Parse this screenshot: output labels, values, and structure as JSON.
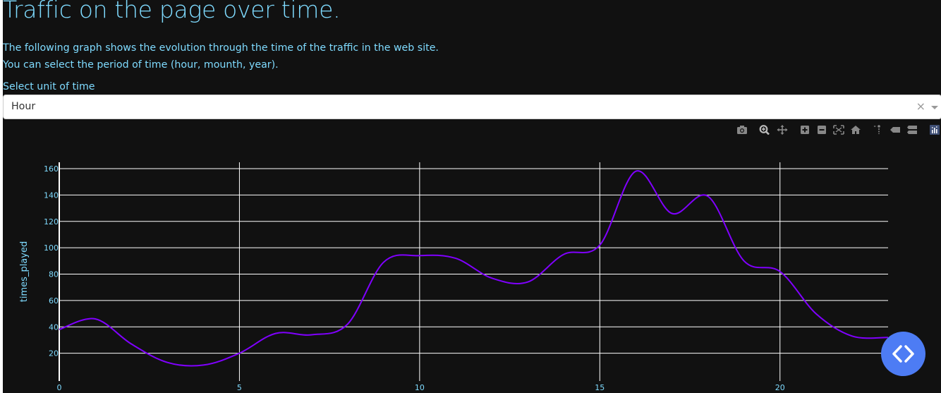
{
  "page": {
    "title": "Traffic on the page over time.",
    "description_line1": "The following graph shows the evolution through the time of the traffic in the web site.",
    "description_line2": "You can select the period of time (hour, mounth, year).",
    "select_label": "Select unit of time",
    "select_value": "Hour",
    "clear_symbol": "×"
  },
  "modebar": {
    "buttons": [
      "camera-icon",
      "zoom-icon",
      "pan-icon",
      "zoom-in-icon",
      "zoom-out-icon",
      "autoscale-icon",
      "reset-axes-icon",
      "spike-lines-icon",
      "hover-closest-icon",
      "hover-compare-icon",
      "plotly-logo-icon"
    ]
  },
  "colors": {
    "accent_text": "#7fdbff",
    "background": "#111111",
    "line": "#8000ff",
    "grid": "#ffffff",
    "fab": "#4d7cf4"
  },
  "chart_data": {
    "type": "line",
    "ylabel": "times_played",
    "xlabel": "",
    "x": [
      0,
      1,
      2,
      3,
      4,
      5,
      6,
      7,
      8,
      9,
      10,
      11,
      12,
      13,
      14,
      15,
      16,
      17,
      18,
      19,
      20,
      21,
      22,
      23
    ],
    "series": [
      {
        "values": [
          38,
          46,
          27,
          13,
          11,
          20,
          35,
          34,
          42,
          89,
          94,
          92,
          77,
          74,
          95,
          102,
          158,
          126,
          139,
          90,
          82,
          50,
          33,
          32
        ]
      }
    ],
    "xlim": [
      0,
      23
    ],
    "ylim": [
      0,
      166
    ],
    "xticks": [
      0,
      5,
      10,
      15,
      20
    ],
    "yticks": [
      20,
      40,
      60,
      80,
      100,
      120,
      140,
      160
    ],
    "smoothing": "spline",
    "grid": true
  },
  "fab": {
    "icon": "code-brackets-icon"
  }
}
